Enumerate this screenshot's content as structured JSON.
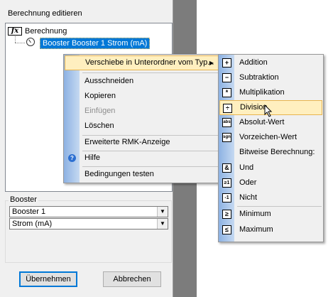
{
  "dialog": {
    "title": "Berechnung editieren",
    "tree": {
      "root_label": "Berechnung",
      "child_label": "Booster Booster 1 Strom (mA)"
    },
    "group": {
      "label": "Booster",
      "combo1_value": "Booster 1",
      "combo2_value": "Strom (mA)"
    },
    "buttons": {
      "ok": "Übernehmen",
      "cancel": "Abbrechen"
    }
  },
  "context_menu": {
    "items": [
      {
        "label": "Verschiebe in Unterordner vom Typ...",
        "state": "highlighted"
      },
      {
        "label": "Ausschneiden"
      },
      {
        "label": "Kopieren"
      },
      {
        "label": "Einfügen",
        "state": "disabled"
      },
      {
        "label": "Löschen"
      },
      {
        "label": "Erweiterte RMK-Anzeige"
      },
      {
        "label": "Hilfe",
        "icon": "help-icon"
      },
      {
        "label": "Bedingungen testen"
      }
    ]
  },
  "submenu": {
    "items": [
      {
        "label": "Addition",
        "icon": "+"
      },
      {
        "label": "Subtraktion",
        "icon": "−"
      },
      {
        "label": "Multiplikation",
        "icon": "*"
      },
      {
        "label": "Division",
        "icon": "÷",
        "state": "highlighted"
      },
      {
        "label": "Absolut-Wert",
        "icon": "abs"
      },
      {
        "label": "Vorzeichen-Wert",
        "icon": "sgn"
      },
      {
        "label": "Bitweise Berechnung:"
      },
      {
        "label": "Und",
        "icon": "&"
      },
      {
        "label": "Oder",
        "icon": "≥1"
      },
      {
        "label": "Nicht",
        "icon": "-1"
      },
      {
        "label": "Minimum",
        "icon": "≥"
      },
      {
        "label": "Maximum",
        "icon": "≤"
      }
    ]
  },
  "colors": {
    "selection": "#0078d7",
    "menu_highlight": "#ffefbf",
    "menu_gutter": "#8db2e3"
  }
}
